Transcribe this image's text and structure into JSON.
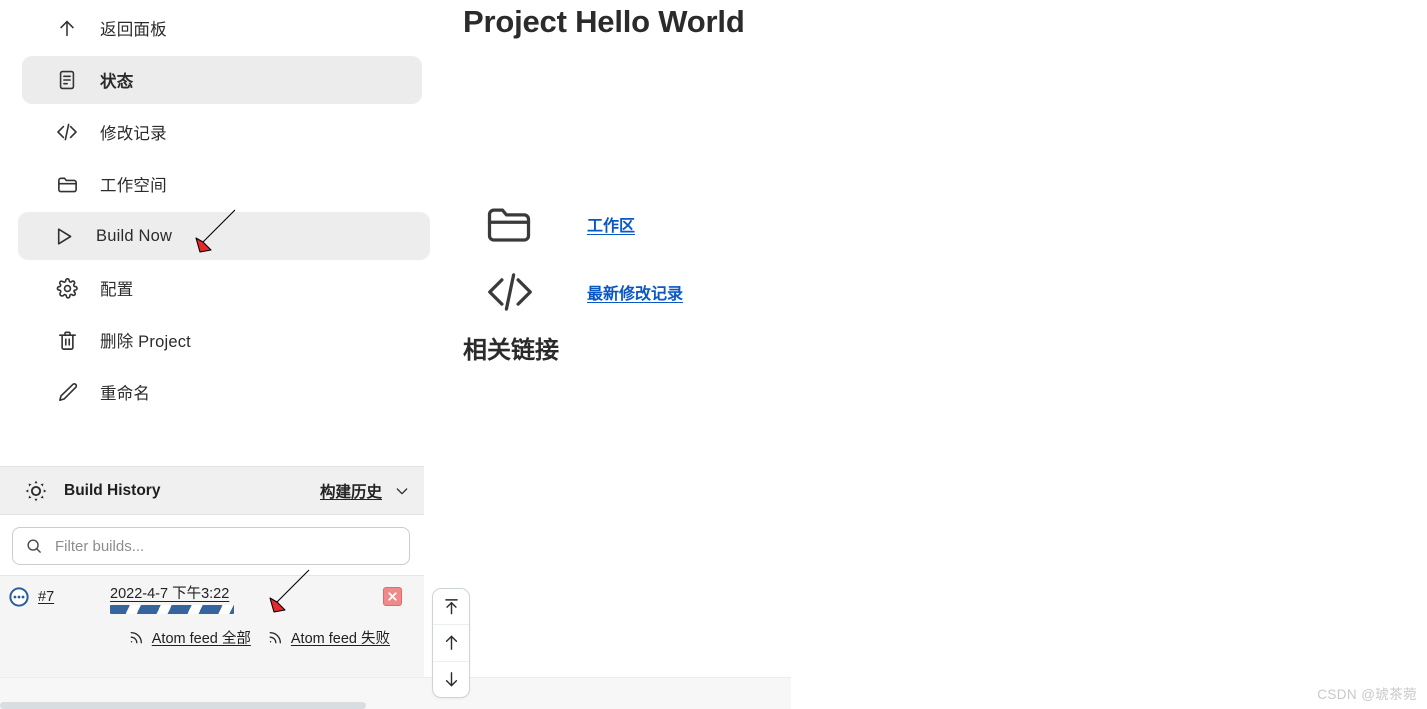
{
  "sidebar": {
    "tasks": [
      {
        "label": "返回面板",
        "icon": "arrow-up-icon",
        "state": "normal"
      },
      {
        "label": "状态",
        "icon": "document-icon",
        "state": "active"
      },
      {
        "label": "修改记录",
        "icon": "code-icon",
        "state": "normal"
      },
      {
        "label": "工作空间",
        "icon": "folder-icon",
        "state": "normal"
      },
      {
        "label": "Build Now",
        "icon": "play-icon",
        "state": "hovered"
      },
      {
        "label": "配置",
        "icon": "gear-icon",
        "state": "normal"
      },
      {
        "label": "删除 Project",
        "icon": "trash-icon",
        "state": "normal"
      },
      {
        "label": "重命名",
        "icon": "pencil-icon",
        "state": "normal"
      }
    ],
    "build_history": {
      "title": "Build History",
      "header_icon": "weather-sun-icon",
      "dropdown_label": "构建历史",
      "dropdown_icon": "chevron-down-icon",
      "filter": {
        "icon": "search-icon",
        "value": "",
        "placeholder": "Filter builds..."
      },
      "builds": [
        {
          "number": "#7",
          "timestamp": "2022-4-7 下午3:22",
          "status_icon": "in-progress-blue-icon",
          "in_progress": true,
          "stop_icon": "stop-x-icon"
        }
      ],
      "feeds": [
        {
          "label": "Atom feed 全部",
          "icon": "rss-icon"
        },
        {
          "label": "Atom feed 失败",
          "icon": "rss-icon"
        }
      ]
    },
    "scroll_buttons": [
      {
        "name": "scroll-to-top",
        "icon": "arrow-to-top-icon"
      },
      {
        "name": "scroll-up",
        "icon": "arrow-up-icon"
      },
      {
        "name": "scroll-down",
        "icon": "arrow-down-icon"
      }
    ]
  },
  "main": {
    "title": "Project Hello World",
    "links": [
      {
        "label": "工作区",
        "icon": "folder-icon"
      },
      {
        "label": "最新修改记录",
        "icon": "code-icon"
      }
    ],
    "related_links_heading": "相关链接"
  },
  "watermark": "CSDN @琥茶菀",
  "colors": {
    "link": "#0b58c4",
    "progress": "#35649f",
    "active_bg": "#ececec",
    "panel_bg": "#f5f5f5",
    "annotation_arrow": "#e8272c"
  }
}
